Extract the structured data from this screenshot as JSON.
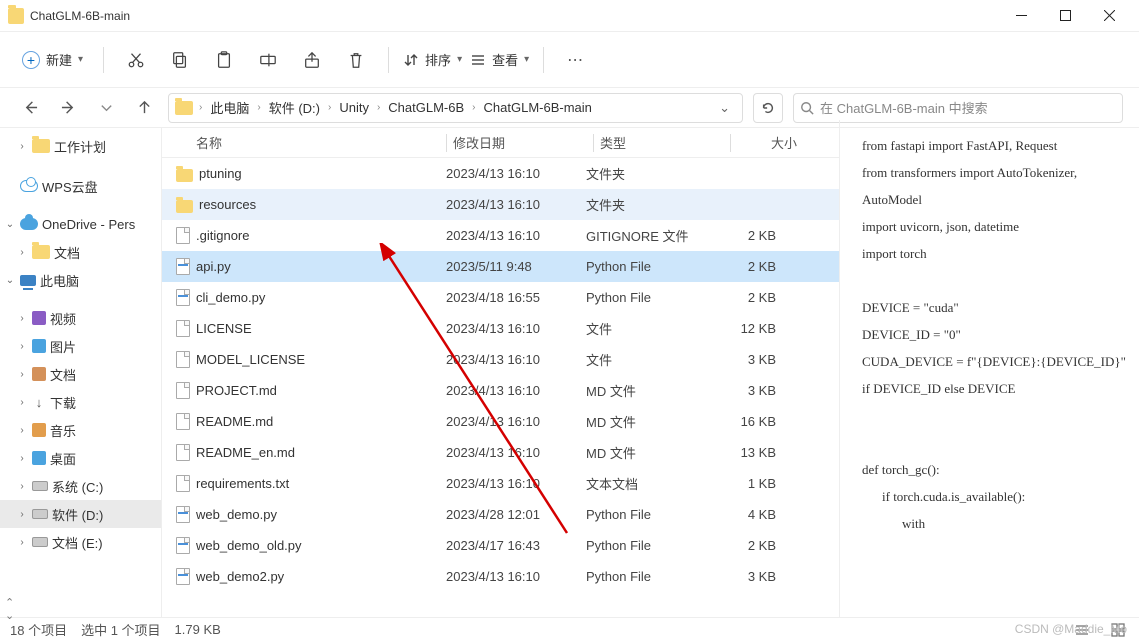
{
  "window": {
    "title": "ChatGLM-6B-main"
  },
  "toolbar": {
    "new_label": "新建",
    "sort_label": "排序",
    "view_label": "查看"
  },
  "breadcrumb": {
    "items": [
      "此电脑",
      "软件 (D:)",
      "Unity",
      "ChatGLM-6B",
      "ChatGLM-6B-main"
    ]
  },
  "search": {
    "placeholder": "在 ChatGLM-6B-main 中搜索"
  },
  "sidebar": {
    "items": [
      {
        "label": "工作计划",
        "icon": "folder",
        "indent": 1
      },
      {
        "label": "WPS云盘",
        "icon": "cloud-w",
        "indent": 0
      },
      {
        "label": "OneDrive - Pers",
        "icon": "cloud",
        "indent": 0,
        "expand": "open"
      },
      {
        "label": "文档",
        "icon": "folder",
        "indent": 1
      },
      {
        "label": "此电脑",
        "icon": "pc",
        "indent": 0,
        "expand": "open"
      },
      {
        "label": "视频",
        "icon": "vid",
        "indent": 1
      },
      {
        "label": "图片",
        "icon": "pic",
        "indent": 1
      },
      {
        "label": "文档",
        "icon": "doc",
        "indent": 1
      },
      {
        "label": "下载",
        "icon": "down",
        "indent": 1
      },
      {
        "label": "音乐",
        "icon": "music",
        "indent": 1
      },
      {
        "label": "桌面",
        "icon": "pic",
        "indent": 1
      },
      {
        "label": "系统 (C:)",
        "icon": "disk",
        "indent": 1
      },
      {
        "label": "软件 (D:)",
        "icon": "disk",
        "indent": 1,
        "sel": true
      },
      {
        "label": "文档 (E:)",
        "icon": "disk",
        "indent": 1
      }
    ]
  },
  "columns": {
    "name": "名称",
    "date": "修改日期",
    "type": "类型",
    "size": "大小"
  },
  "files": [
    {
      "icon": "folder",
      "name": "ptuning",
      "date": "2023/4/13 16:10",
      "type": "文件夹",
      "size": ""
    },
    {
      "icon": "folder",
      "name": "resources",
      "date": "2023/4/13 16:10",
      "type": "文件夹",
      "size": "",
      "hov": true
    },
    {
      "icon": "file",
      "name": ".gitignore",
      "date": "2023/4/13 16:10",
      "type": "GITIGNORE 文件",
      "size": "2 KB"
    },
    {
      "icon": "py",
      "name": "api.py",
      "date": "2023/5/11 9:48",
      "type": "Python File",
      "size": "2 KB",
      "sel": true
    },
    {
      "icon": "py",
      "name": "cli_demo.py",
      "date": "2023/4/18 16:55",
      "type": "Python File",
      "size": "2 KB"
    },
    {
      "icon": "file",
      "name": "LICENSE",
      "date": "2023/4/13 16:10",
      "type": "文件",
      "size": "12 KB"
    },
    {
      "icon": "file",
      "name": "MODEL_LICENSE",
      "date": "2023/4/13 16:10",
      "type": "文件",
      "size": "3 KB"
    },
    {
      "icon": "file",
      "name": "PROJECT.md",
      "date": "2023/4/13 16:10",
      "type": "MD 文件",
      "size": "3 KB"
    },
    {
      "icon": "file",
      "name": "README.md",
      "date": "2023/4/13 16:10",
      "type": "MD 文件",
      "size": "16 KB"
    },
    {
      "icon": "file",
      "name": "README_en.md",
      "date": "2023/4/13 16:10",
      "type": "MD 文件",
      "size": "13 KB"
    },
    {
      "icon": "file",
      "name": "requirements.txt",
      "date": "2023/4/13 16:10",
      "type": "文本文档",
      "size": "1 KB"
    },
    {
      "icon": "py",
      "name": "web_demo.py",
      "date": "2023/4/28 12:01",
      "type": "Python File",
      "size": "4 KB"
    },
    {
      "icon": "py",
      "name": "web_demo_old.py",
      "date": "2023/4/17 16:43",
      "type": "Python File",
      "size": "2 KB"
    },
    {
      "icon": "py",
      "name": "web_demo2.py",
      "date": "2023/4/13 16:10",
      "type": "Python File",
      "size": "3 KB"
    }
  ],
  "preview": {
    "lines": [
      "from fastapi import FastAPI, Request",
      "from transformers import AutoTokenizer, AutoModel",
      "import uvicorn, json, datetime",
      "import torch",
      "",
      "DEVICE = \"cuda\"",
      "DEVICE_ID = \"0\"",
      "CUDA_DEVICE = f\"{DEVICE}:{DEVICE_ID}\" if DEVICE_ID else DEVICE",
      "",
      "",
      "def torch_gc():",
      "    if torch.cuda.is_available():",
      "        with"
    ]
  },
  "status": {
    "items": "18 个项目",
    "selected": "选中 1 个项目",
    "size": "1.79 KB"
  },
  "watermark": "CSDN @Maddie_Mo"
}
